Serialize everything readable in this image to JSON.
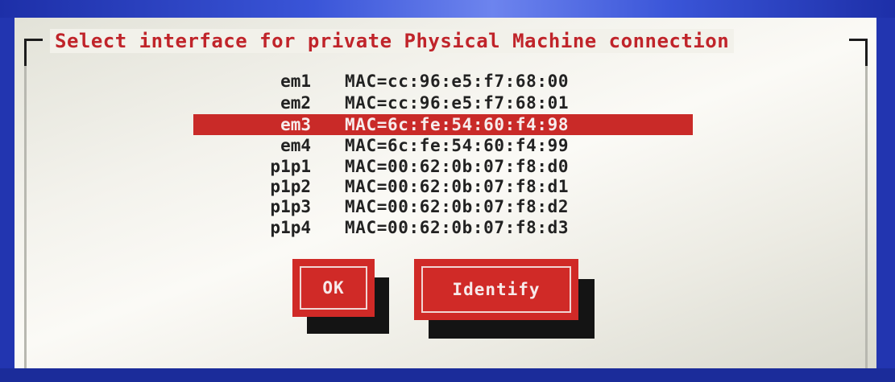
{
  "dialog": {
    "title": "Select interface for private Physical Machine connection"
  },
  "interfaces": [
    {
      "name": "em1",
      "mac": "MAC=cc:96:e5:f7:68:00",
      "selected": false
    },
    {
      "name": "em2",
      "mac": "MAC=cc:96:e5:f7:68:01",
      "selected": false
    },
    {
      "name": "em3",
      "mac": "MAC=6c:fe:54:60:f4:98",
      "selected": true
    },
    {
      "name": "em4",
      "mac": "MAC=6c:fe:54:60:f4:99",
      "selected": false
    },
    {
      "name": "p1p1",
      "mac": "MAC=00:62:0b:07:f8:d0",
      "selected": false
    },
    {
      "name": "p1p2",
      "mac": "MAC=00:62:0b:07:f8:d1",
      "selected": false
    },
    {
      "name": "p1p3",
      "mac": "MAC=00:62:0b:07:f8:d2",
      "selected": false
    },
    {
      "name": "p1p4",
      "mac": "MAC=00:62:0b:07:f8:d3",
      "selected": false
    }
  ],
  "buttons": {
    "ok_label": "OK",
    "identify_label": "Identify"
  },
  "colors": {
    "accent": "#d02a27",
    "title_text": "#c0242a",
    "screen_background": "#2b3fb8"
  }
}
